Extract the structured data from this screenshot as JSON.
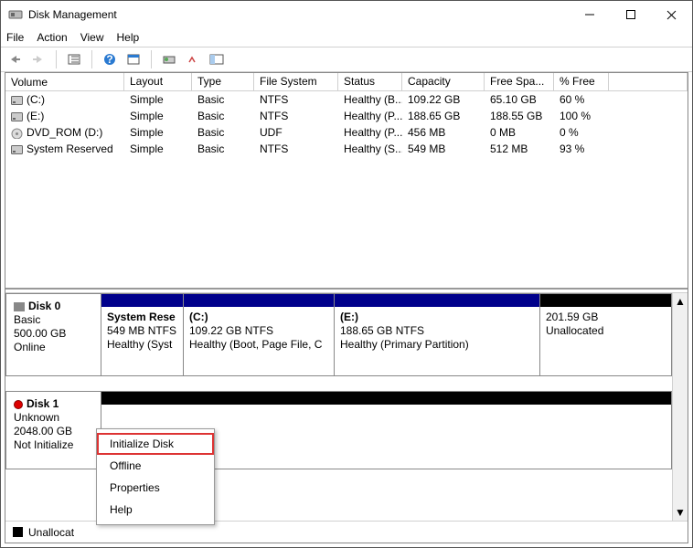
{
  "window": {
    "title": "Disk Management"
  },
  "menubar": {
    "items": [
      "File",
      "Action",
      "View",
      "Help"
    ]
  },
  "columns": {
    "volume": "Volume",
    "layout": "Layout",
    "type": "Type",
    "fs": "File System",
    "status": "Status",
    "capacity": "Capacity",
    "free": "Free Spa...",
    "pct": "% Free"
  },
  "volumes": [
    {
      "name": "(C:)",
      "layout": "Simple",
      "type": "Basic",
      "fs": "NTFS",
      "status": "Healthy (B...",
      "capacity": "109.22 GB",
      "free": "65.10 GB",
      "pct": "60 %",
      "icon": "drive"
    },
    {
      "name": "(E:)",
      "layout": "Simple",
      "type": "Basic",
      "fs": "NTFS",
      "status": "Healthy (P...",
      "capacity": "188.65 GB",
      "free": "188.55 GB",
      "pct": "100 %",
      "icon": "drive"
    },
    {
      "name": "DVD_ROM (D:)",
      "layout": "Simple",
      "type": "Basic",
      "fs": "UDF",
      "status": "Healthy (P...",
      "capacity": "456 MB",
      "free": "0 MB",
      "pct": "0 %",
      "icon": "disc"
    },
    {
      "name": "System Reserved",
      "layout": "Simple",
      "type": "Basic",
      "fs": "NTFS",
      "status": "Healthy (S...",
      "capacity": "549 MB",
      "free": "512 MB",
      "pct": "93 %",
      "icon": "drive"
    }
  ],
  "disks": {
    "d0": {
      "title": "Disk 0",
      "type": "Basic",
      "size": "500.00 GB",
      "state": "Online",
      "parts": {
        "p0": {
          "name": "System Rese",
          "line2": "549 MB NTFS",
          "line3": "Healthy (Syst",
          "cap": "navy"
        },
        "p1": {
          "name": "(C:)",
          "line2": "109.22 GB NTFS",
          "line3": "Healthy (Boot, Page File, C",
          "cap": "navy"
        },
        "p2": {
          "name": "(E:)",
          "line2": "188.65 GB NTFS",
          "line3": "Healthy (Primary Partition)",
          "cap": "navy"
        },
        "p3": {
          "name": "",
          "line2": "201.59 GB",
          "line3": "Unallocated",
          "cap": "black"
        }
      }
    },
    "d1": {
      "title": "Disk 1",
      "type": "Unknown",
      "size": "2048.00 GB",
      "state": "Not Initialize",
      "parts": {
        "p0": {
          "name": "",
          "line2": "",
          "line3": "",
          "cap": "black"
        }
      }
    }
  },
  "legend": {
    "unallocated": "Unallocat"
  },
  "context_menu": {
    "items": {
      "init": "Initialize Disk",
      "offline": "Offline",
      "props": "Properties",
      "help": "Help"
    }
  }
}
